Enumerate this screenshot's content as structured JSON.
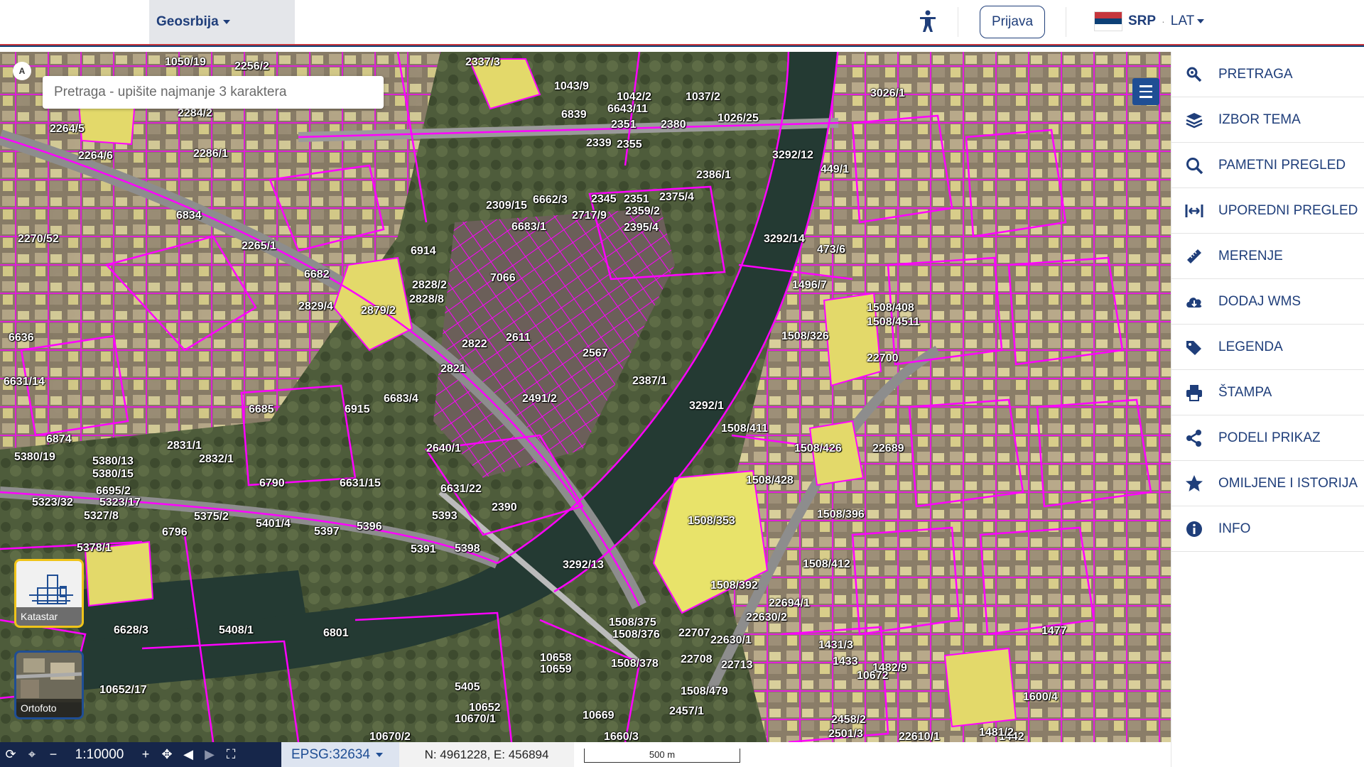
{
  "header": {
    "brand_label": "Geosrbija",
    "login_label": "Prijava",
    "lang_primary": "SRP",
    "lang_sep": "·",
    "lang_script": "LAT"
  },
  "search": {
    "placeholder": "Pretraga - upišite najmanje 3 karaktera"
  },
  "north_label": "A",
  "layers": {
    "katastar": "Katastar",
    "ortofoto": "Ortofoto"
  },
  "bottom": {
    "scale": "1:10000",
    "epsg": "EPSG:32634",
    "coords": "N: 4961228, E: 456894",
    "scalebar": "500 m"
  },
  "panel": {
    "items": [
      {
        "label": "PRETRAGA",
        "icon": "search-pin-icon"
      },
      {
        "label": "IZBOR TEMA",
        "icon": "layers-icon"
      },
      {
        "label": "PAMETNI PREGLED",
        "icon": "magnifier-icon"
      },
      {
        "label": "UPOREDNI PREGLED",
        "icon": "compare-icon"
      },
      {
        "label": "MERENJE",
        "icon": "ruler-icon"
      },
      {
        "label": "DODAJ WMS",
        "icon": "cloud-download-icon"
      },
      {
        "label": "LEGENDA",
        "icon": "tags-icon"
      },
      {
        "label": "ŠTAMPA",
        "icon": "print-icon"
      },
      {
        "label": "PODELI PRIKAZ",
        "icon": "share-icon"
      },
      {
        "label": "OMILJENE I ISTORIJA",
        "icon": "star-icon"
      },
      {
        "label": "INFO",
        "icon": "info-icon"
      }
    ]
  },
  "map_labels": [
    "1050/19",
    "2256/2",
    "2337/3",
    "1043/9",
    "1042/2",
    "1037/2",
    "6643/11",
    "3026/1",
    "2264/5",
    "6839",
    "2351",
    "2380",
    "1026/25",
    "2284/2",
    "2264/6",
    "2339",
    "2355",
    "3292/12",
    "449/1",
    "2286/1",
    "2386/1",
    "6834",
    "2345",
    "2351",
    "2375/4",
    "2359/2",
    "2395/4",
    "2717/9",
    "6683/1",
    "6662/3",
    "2309/15",
    "3292/14",
    "473/6",
    "2265/1",
    "2270/52",
    "6914",
    "7066",
    "6682",
    "2829/4",
    "2879/2",
    "2828/2",
    "2828/8",
    "1496/7",
    "1508/408",
    "1508/4511",
    "2822",
    "2611",
    "2567",
    "2387/1",
    "1508/326",
    "22700",
    "6636",
    "6631/14",
    "2821",
    "2491/2",
    "6683/4",
    "3292/1",
    "1508/411",
    "2831/1",
    "6915",
    "2640/1",
    "6685",
    "6874",
    "5380/19",
    "5380/13",
    "5380/15",
    "2832/1",
    "6790",
    "6631/15",
    "6631/22",
    "1508/428",
    "1508/426",
    "22689",
    "5323/32",
    "5323/17",
    "6695/2",
    "5327/8",
    "5375/2",
    "5396",
    "5393",
    "2390",
    "1508/396",
    "1508/353",
    "5378/1",
    "6796",
    "5401/4",
    "5397",
    "5398",
    "5391",
    "3292/13",
    "1508/412",
    "1508/392",
    "22694/1",
    "22630/2",
    "1508/375",
    "1508/376",
    "6628/3",
    "5408/1",
    "6801",
    "22707",
    "22630/1",
    "22708",
    "22713",
    "1431/3",
    "1433",
    "1482/9",
    "10658",
    "10659",
    "1508/378",
    "1508/479",
    "10672",
    "5405",
    "10652/17",
    "10652",
    "10670/1",
    "10669",
    "2457/1",
    "2458/2",
    "2501/3",
    "22610/1",
    "10670/2",
    "1660/3",
    "1442",
    "1477",
    "1600/4",
    "1481/2"
  ]
}
